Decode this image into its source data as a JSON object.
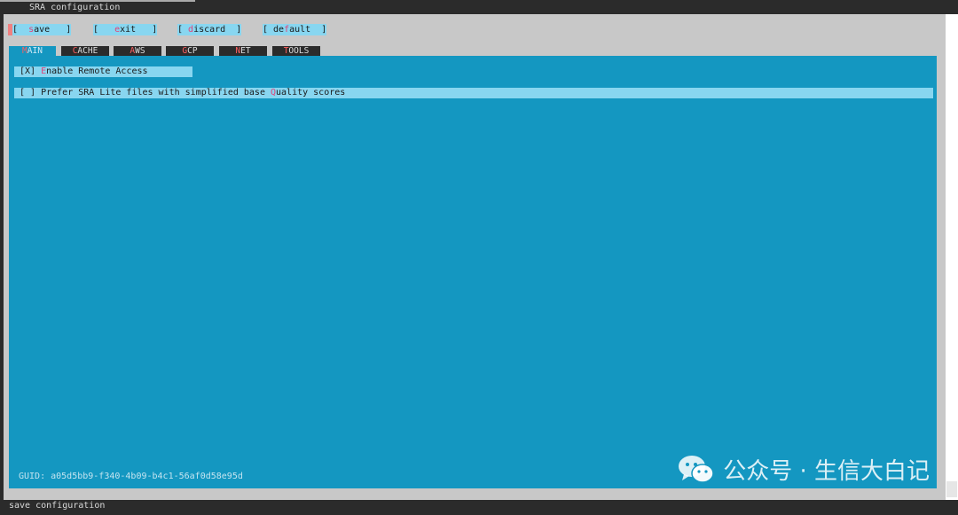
{
  "window": {
    "title": "SRA configuration"
  },
  "buttons": [
    {
      "pre": "[  ",
      "hot": "s",
      "post": "ave   ]"
    },
    {
      "pre": "[   ",
      "hot": "e",
      "post": "xit   ]"
    },
    {
      "pre": "[ ",
      "hot": "d",
      "post": "iscard  ]"
    },
    {
      "pre": "[ de",
      "hot": "f",
      "post": "ault  ]"
    }
  ],
  "tabs": [
    {
      "hot": "M",
      "rest": "AIN",
      "active": true
    },
    {
      "hot": "C",
      "rest": "ACHE"
    },
    {
      "hot": "A",
      "rest": "WS"
    },
    {
      "hot": "G",
      "rest": "CP"
    },
    {
      "hot": "N",
      "rest": "ET"
    },
    {
      "hot": "T",
      "rest": "OOLS"
    }
  ],
  "options": [
    {
      "pre": " [X] ",
      "hot": "E",
      "post": "nable Remote Access",
      "checked": true
    },
    {
      "pre": " [ ] Prefer SRA Lite files with simplified base ",
      "hot": "Q",
      "post": "uality scores",
      "checked": false
    }
  ],
  "guid": "GUID: a05d5bb9-f340-4b09-b4c1-56af0d58e95d",
  "watermark": {
    "text": "公众号 · 生信大白记",
    "icon": "wechat-icon"
  },
  "statusbar": {
    "text": "save configuration"
  }
}
